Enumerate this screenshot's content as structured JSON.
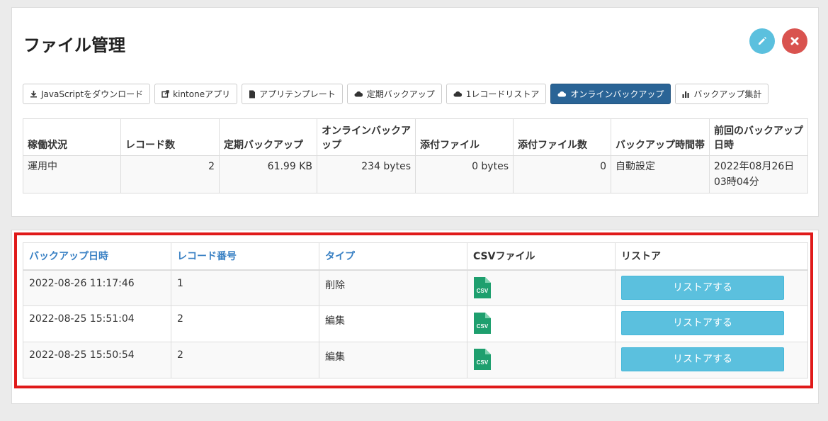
{
  "header": {
    "title": "ファイル管理",
    "edit_icon": "pencil-icon",
    "close_icon": "close-icon",
    "colors": {
      "edit": "#5bc0de",
      "close": "#d9534f"
    }
  },
  "toolbar": {
    "buttons": [
      {
        "label": "JavaScriptをダウンロード",
        "icon": "download-icon"
      },
      {
        "label": "kintoneアプリ",
        "icon": "external-link-icon"
      },
      {
        "label": "アプリテンプレート",
        "icon": "file-icon"
      },
      {
        "label": "定期バックアップ",
        "icon": "cloud-icon"
      },
      {
        "label": "1レコードリストア",
        "icon": "cloud-icon"
      },
      {
        "label": "オンラインバックアップ",
        "icon": "cloud-icon",
        "active": true
      },
      {
        "label": "バックアップ集計",
        "icon": "bar-chart-icon"
      }
    ]
  },
  "stats": {
    "headers": [
      "稼働状況",
      "レコード数",
      "定期バックアップ",
      "オンラインバックアップ",
      "添付ファイル",
      "添付ファイル数",
      "バックアップ時間帯",
      "前回のバックアップ日時"
    ],
    "values": [
      "運用中",
      "2",
      "61.99 KB",
      "234 bytes",
      "0 bytes",
      "0",
      "自動設定",
      "2022年08月26日03時04分"
    ]
  },
  "backups": {
    "headers": [
      "バックアップ日時",
      "レコード番号",
      "タイプ",
      "CSVファイル",
      "リストア"
    ],
    "rows": [
      {
        "datetime": "2022-08-26 11:17:46",
        "record": "1",
        "type": "削除",
        "csv": "CSV",
        "restore": "リストアする"
      },
      {
        "datetime": "2022-08-25 15:51:04",
        "record": "2",
        "type": "編集",
        "csv": "CSV",
        "restore": "リストアする"
      },
      {
        "datetime": "2022-08-25 15:50:54",
        "record": "2",
        "type": "編集",
        "csv": "CSV",
        "restore": "リストアする"
      }
    ]
  }
}
